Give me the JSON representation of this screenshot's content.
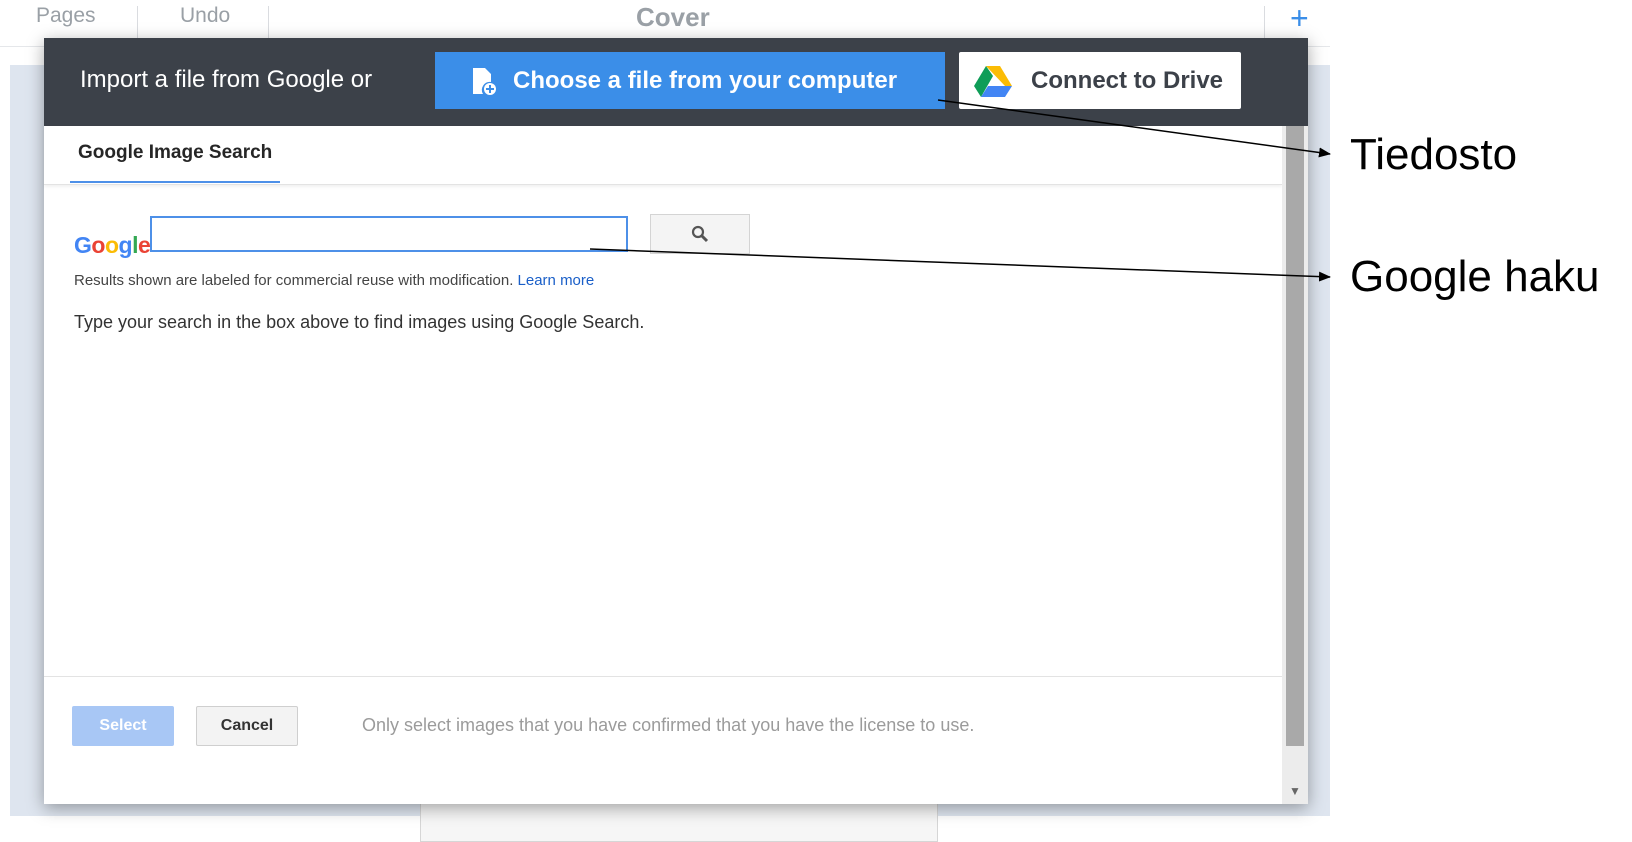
{
  "app": {
    "pages_label": "Pages",
    "undo_label": "Undo",
    "cover_title": "Cover",
    "plus_symbol": "+"
  },
  "dialog": {
    "header": {
      "import_text": "Import a file from Google or",
      "choose_file_label": "Choose a file from your computer",
      "connect_drive_label": "Connect to Drive"
    },
    "tabs": [
      {
        "label": "Google Image Search",
        "active": true
      }
    ],
    "search": {
      "logo_letters": [
        "G",
        "o",
        "o",
        "g",
        "l",
        "e"
      ],
      "query_value": "",
      "results_note": "Results shown are labeled for commercial reuse with modification.",
      "learn_more_label": "Learn more",
      "hint_text": "Type your search in the box above to find images using Google Search."
    },
    "footer": {
      "select_label": "Select",
      "cancel_label": "Cancel",
      "note": "Only select images that you have confirmed that you have the license to use."
    }
  },
  "annotations": {
    "file_label": "Tiedosto",
    "search_label": "Google haku"
  },
  "colors": {
    "header_bg": "#3c4149",
    "primary_blue": "#3b8ee8",
    "select_disabled": "#a8c7f5",
    "canvas_bg": "#dee5ef"
  }
}
